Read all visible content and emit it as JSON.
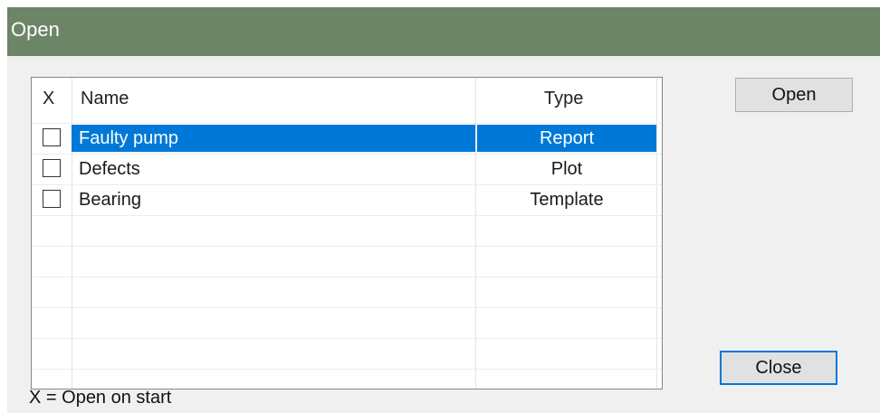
{
  "dialog": {
    "title": "Open"
  },
  "list": {
    "columns": {
      "x": "X",
      "name": "Name",
      "type": "Type"
    },
    "rows": [
      {
        "name": "Faulty pump",
        "type": "Report",
        "checked": false,
        "selected": true
      },
      {
        "name": "Defects",
        "type": "Plot",
        "checked": false,
        "selected": false
      },
      {
        "name": "Bearing",
        "type": "Template",
        "checked": false,
        "selected": false
      }
    ]
  },
  "buttons": {
    "open": "Open",
    "close": "Close"
  },
  "footnote": "X = Open on start",
  "colors": {
    "titlebar": "#6b8566",
    "selection": "#0078d7",
    "default_button_border": "#0078d7"
  }
}
